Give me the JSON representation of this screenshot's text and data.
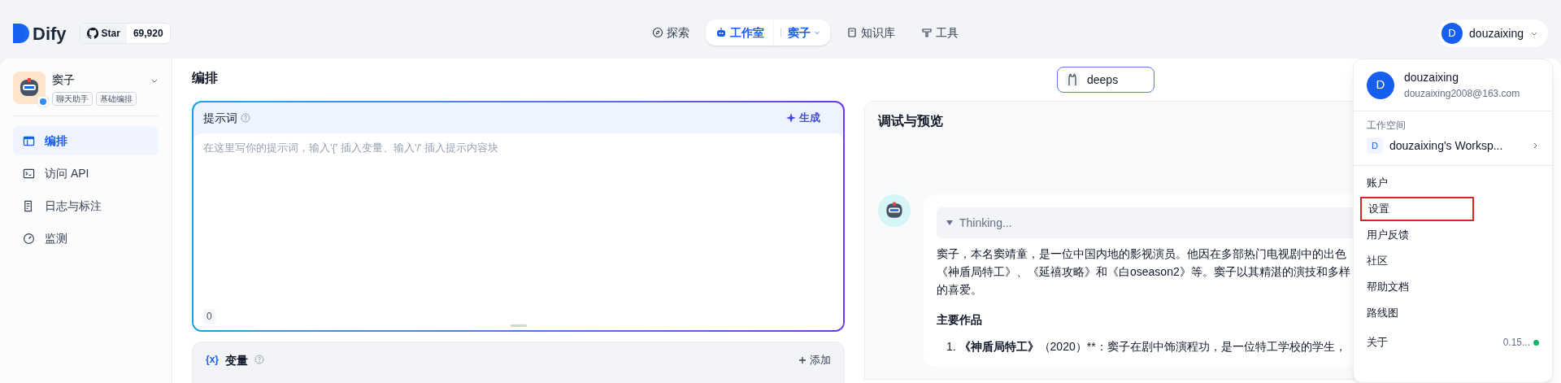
{
  "header": {
    "logo": "Dify",
    "star_label": "Star",
    "star_count": "69,920",
    "nav": [
      {
        "label": "探索",
        "selected": false
      },
      {
        "label": "工作室",
        "selected": true,
        "sub": "窦子"
      },
      {
        "label": "知识库",
        "selected": false
      },
      {
        "label": "工具",
        "selected": false
      }
    ],
    "user": {
      "initial": "D",
      "name": "douzaixing"
    }
  },
  "app": {
    "name": "窦子",
    "tags": [
      "聊天助手",
      "基础编排"
    ]
  },
  "sidebar": {
    "items": [
      {
        "label": "编排",
        "selected": true
      },
      {
        "label": "访问 API",
        "selected": false
      },
      {
        "label": "日志与标注",
        "selected": false
      },
      {
        "label": "监测",
        "selected": false
      }
    ]
  },
  "editor": {
    "title": "编排",
    "model_label": "deeps",
    "prompt": {
      "title": "提示词",
      "generate": "生成",
      "placeholder": "在这里写你的提示词，输入'{' 插入变量、输入'/' 插入提示内容块",
      "count": "0"
    },
    "variables": {
      "icon": "{x}",
      "title": "变量",
      "add": "添加"
    }
  },
  "preview": {
    "title": "调试与预览",
    "thinking": "Thinking...",
    "paragraphs": [
      "窦子，本名窦靖童，是一位中国内地的影视演员。他因在多部热门电视剧中的出色",
      "《神盾局特工》、《延禧攻略》和《白oseason2》等。窦子以其精湛的演技和多样",
      "的喜爱。"
    ],
    "heading": "主要作品",
    "list_item": "1. **《神盾局特工》**（2020）**：窦子在剧中饰演程功，是一位特工学校的学生，"
  },
  "menu": {
    "initial": "D",
    "name": "douzaixing",
    "email": "douzaixing2008@163.com",
    "workspace_label": "工作空间",
    "workspace_initial": "D",
    "workspace": "douzaixing's Worksp...",
    "items": [
      {
        "label": "账户",
        "highlighted": false
      },
      {
        "label": "设置",
        "highlighted": true
      },
      {
        "label": "用户反馈",
        "highlighted": false
      },
      {
        "label": "社区",
        "highlighted": false
      },
      {
        "label": "帮助文档",
        "highlighted": false
      },
      {
        "label": "路线图",
        "highlighted": false
      }
    ],
    "about": "关于",
    "version": "0.15..."
  }
}
